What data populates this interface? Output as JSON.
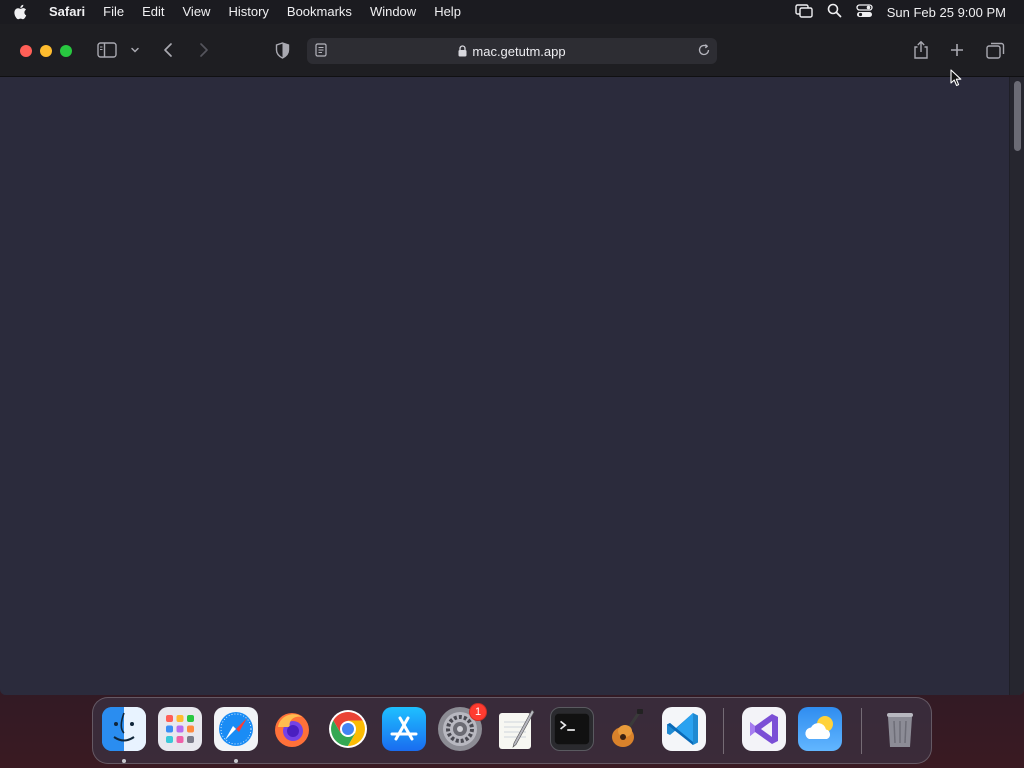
{
  "menubar": {
    "app_name": "Safari",
    "items": [
      "File",
      "Edit",
      "View",
      "History",
      "Bookmarks",
      "Window",
      "Help"
    ],
    "clock": "Sun Feb 25  9:00 PM"
  },
  "browser": {
    "url": "mac.getutm.app"
  },
  "dock": {
    "apps": [
      {
        "name": "Finder",
        "icon": "finder-icon",
        "running": true
      },
      {
        "name": "Launchpad",
        "icon": "launchpad-icon",
        "running": false
      },
      {
        "name": "Safari",
        "icon": "safari-icon",
        "running": true
      },
      {
        "name": "Firefox",
        "icon": "firefox-icon",
        "running": false
      },
      {
        "name": "Chrome",
        "icon": "chrome-icon",
        "running": false
      },
      {
        "name": "App Store",
        "icon": "app-store-icon",
        "running": false
      },
      {
        "name": "System Settings",
        "icon": "system-settings-icon",
        "running": false
      },
      {
        "name": "TextEdit",
        "icon": "textedit-icon",
        "running": false
      },
      {
        "name": "Terminal",
        "icon": "terminal-icon",
        "running": false
      },
      {
        "name": "GarageBand",
        "icon": "garageband-icon",
        "running": false
      },
      {
        "name": "Visual Studio Code",
        "icon": "vscode-icon",
        "running": false
      },
      {
        "name": "Visual Studio",
        "icon": "visual-studio-icon",
        "running": false
      },
      {
        "name": "Weather",
        "icon": "weather-icon",
        "running": false
      },
      {
        "name": "Trash",
        "icon": "trash-icon",
        "running": false
      }
    ],
    "settings_badge": "1"
  },
  "colors": {
    "close": "#ff5f57",
    "minimize": "#febc2e",
    "maximize": "#28c840",
    "content_bg": "#2b2b3c",
    "badge": "#ff3b30"
  }
}
